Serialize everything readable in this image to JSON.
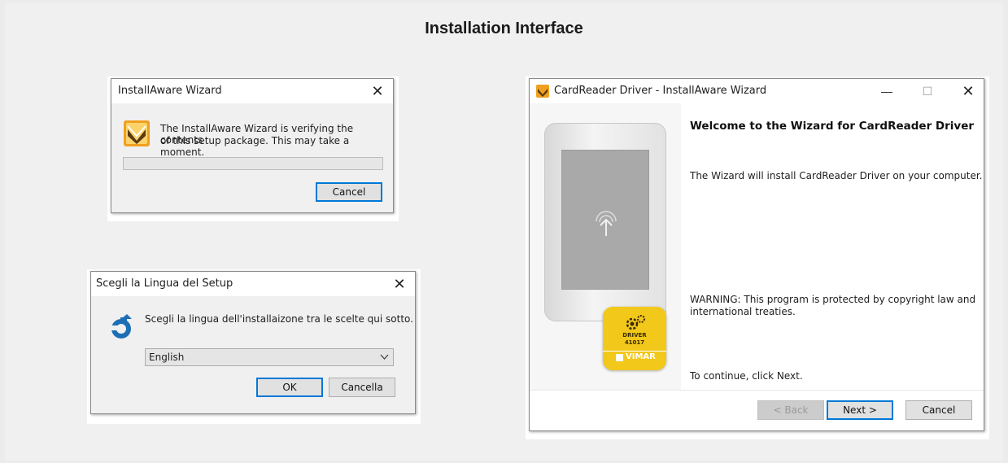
{
  "page": {
    "title": "Installation Interface"
  },
  "verify_dialog": {
    "title": "InstallAware Wizard",
    "message_line1": "The InstallAware Wizard is verifying the contents",
    "message_line2": "of this setup package. This may take a moment.",
    "progress": 0,
    "cancel_label": "Cancel",
    "close_glyph": "✕"
  },
  "language_dialog": {
    "title": "Scegli la Lingua del Setup",
    "message": "Scegli la lingua dell'installaizone tra le scelte qui sotto.",
    "selected_language": "English",
    "ok_label": "OK",
    "cancel_label": "Cancella",
    "close_glyph": "✕"
  },
  "wizard_dialog": {
    "title": "CardReader Driver - InstallAware Wizard",
    "minimize_glyph": "—",
    "maximize_glyph": "☐",
    "close_glyph": "✕",
    "heading": "Welcome to the  Wizard for CardReader Driver",
    "intro": "The  Wizard will install CardReader Driver on your computer.",
    "warning_line1": "WARNING: This program is protected by copyright law and",
    "warning_line2": "international treaties.",
    "continue_text": "To continue, click Next.",
    "back_label": "< Back",
    "next_label": "Next >",
    "cancel_label": "Cancel",
    "badge": {
      "line1": "DRIVER",
      "line2": "41017",
      "brand": "VIMAR"
    }
  },
  "colors": {
    "accent": "#0078d7",
    "badge_yellow": "#f2c81b",
    "brand_orange": "#f0a020"
  }
}
